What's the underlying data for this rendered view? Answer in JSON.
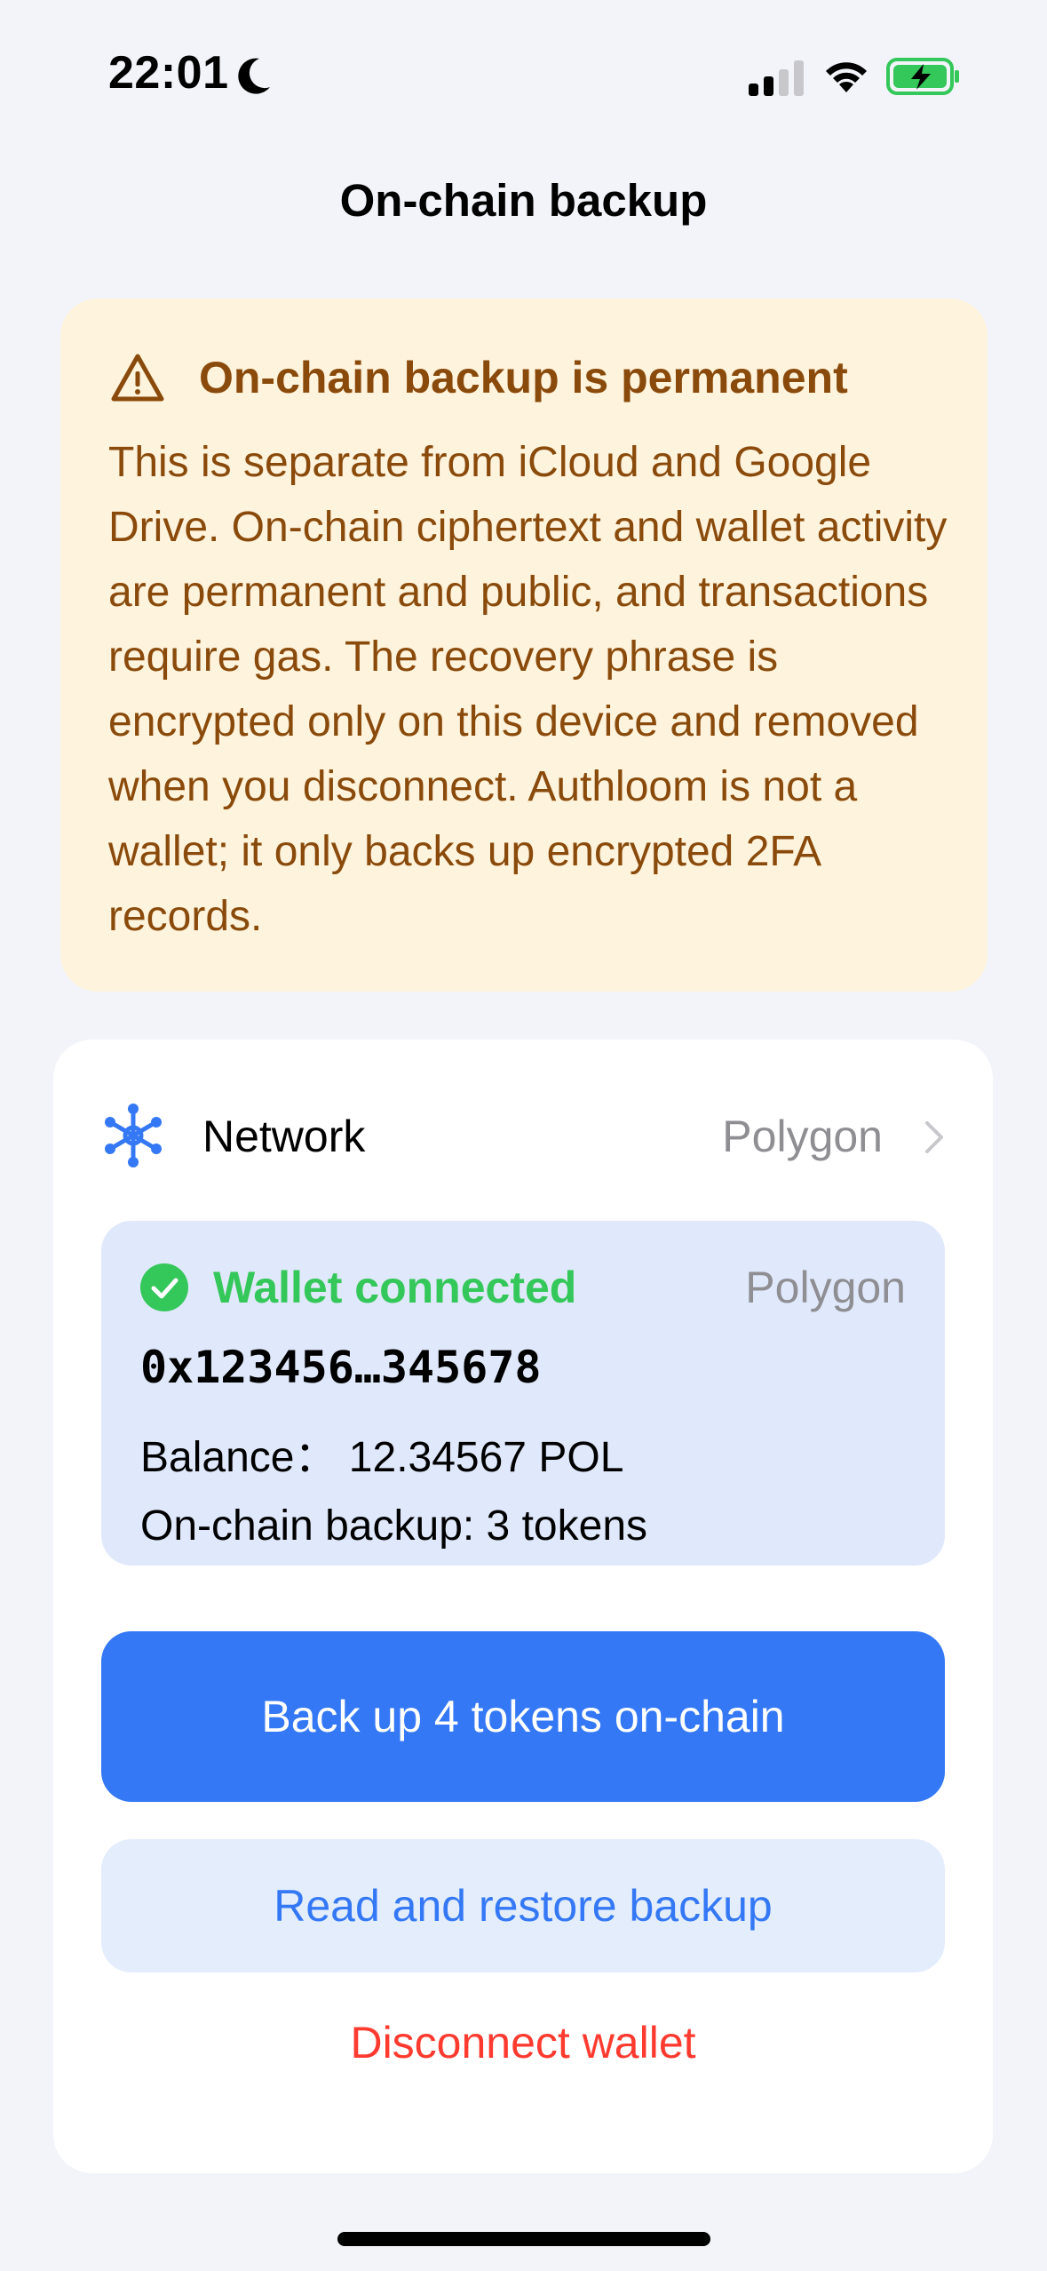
{
  "status_bar": {
    "time": "22:01"
  },
  "nav": {
    "title": "On-chain backup"
  },
  "warning": {
    "title": "On-chain backup is permanent",
    "body": "This is separate from iCloud and Google Drive. On-chain ciphertext and wallet activity are permanent and public, and transactions require gas. The recovery phrase is encrypted only on this device and removed when you disconnect. Authloom is not a wallet; it only backs up encrypted 2FA records."
  },
  "network": {
    "label": "Network",
    "value": "Polygon"
  },
  "wallet": {
    "status": "Wallet connected",
    "network": "Polygon",
    "address": "0x123456…345678",
    "balance": "Balance：  12.34567 POL",
    "backup_count": "On-chain backup: 3 tokens"
  },
  "actions": {
    "backup_label": "Back up 4 tokens on-chain",
    "restore_label": "Read and restore backup",
    "disconnect_label": "Disconnect wallet"
  },
  "colors": {
    "accent": "#3478f6",
    "success": "#34c759",
    "danger": "#ff3b30",
    "warning_text": "#8a4a0b",
    "warning_bg": "#fef3dc"
  },
  "icons": {
    "status": [
      "moon-icon",
      "cellular-signal-icon",
      "wifi-icon",
      "battery-charging-icon"
    ],
    "warning": "warning-triangle-icon",
    "network": "network-nodes-icon",
    "wallet_status": "checkmark-circle-icon",
    "row": "chevron-right-icon"
  }
}
